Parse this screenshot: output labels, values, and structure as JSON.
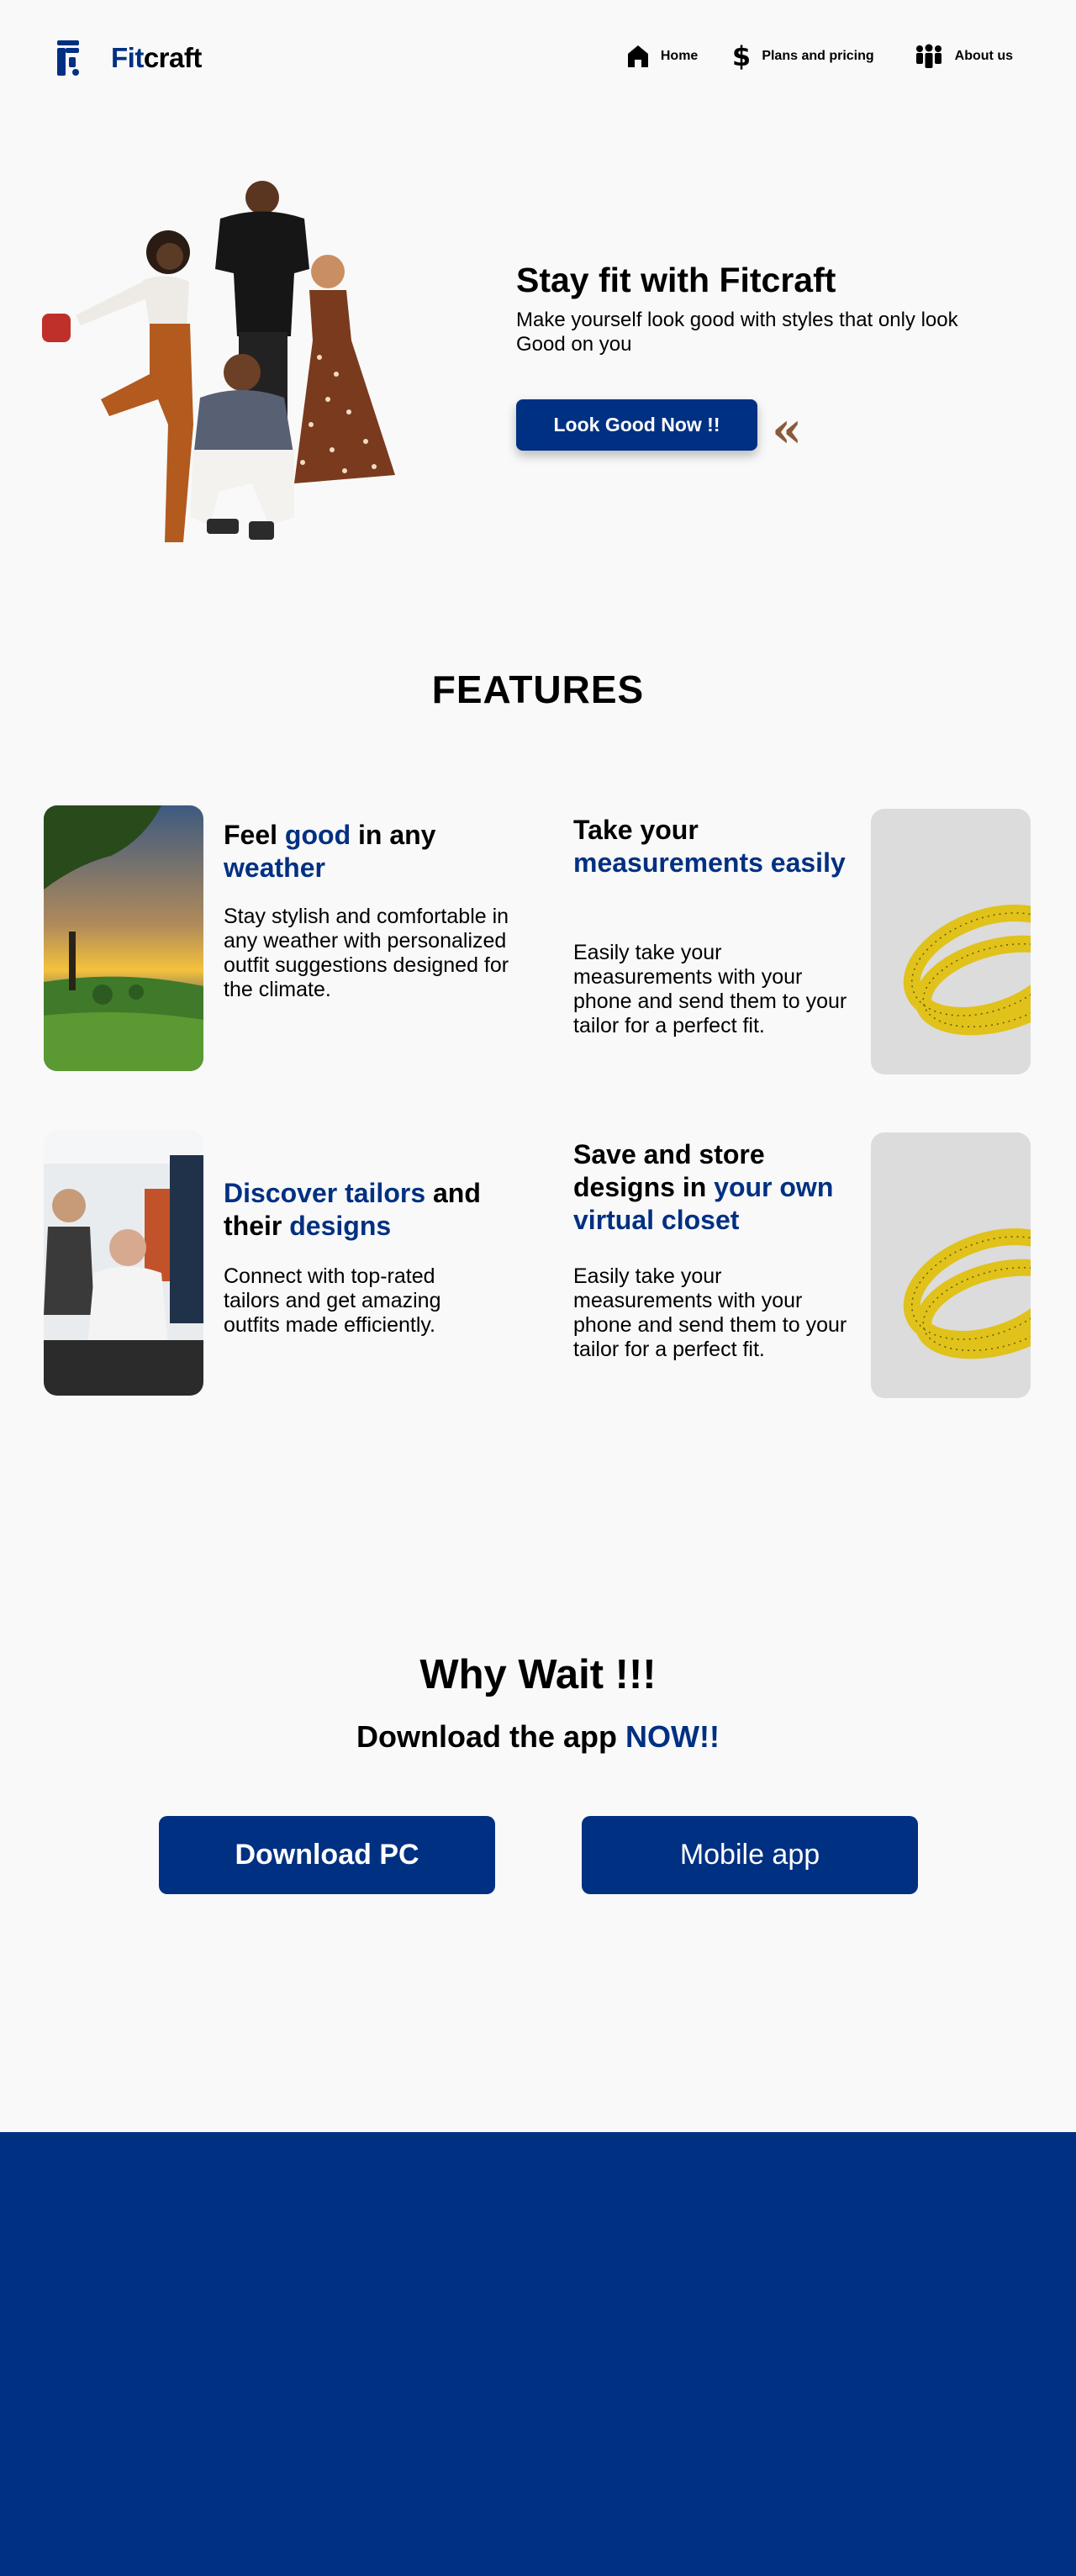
{
  "brand": {
    "prefix": "Fit",
    "suffix": "craft"
  },
  "nav": [
    {
      "icon": "home-icon",
      "label": "Home"
    },
    {
      "icon": "dollar-icon",
      "label": "Plans and pricing"
    },
    {
      "icon": "people-icon",
      "label": "About us"
    }
  ],
  "hero": {
    "title": "Stay fit with Fitcraft",
    "subtitle": "Make yourself look good with styles that only look Good on you",
    "cta": "Look Good Now !!",
    "quote_glyph": "<<"
  },
  "features": {
    "heading": "FEATURES",
    "items": [
      {
        "title_parts": [
          "Feel ",
          "good",
          " in any ",
          "weather"
        ],
        "text": "Stay stylish and comfortable in any weather with personalized outfit suggestions designed for the climate."
      },
      {
        "title_parts": [
          "Take your ",
          "measurements easily"
        ],
        "text": "Easily take your measurements with your phone and send them to your tailor for a perfect fit."
      },
      {
        "title_parts": [
          "Discover tailors",
          " and their ",
          "designs"
        ],
        "text": "Connect with top-rated tailors and get amazing outfits made efficiently."
      },
      {
        "title_parts": [
          "Save and store designs in ",
          "your own virtual closet"
        ],
        "text": "Easily take your measurements with your phone and send them to your tailor for a perfect fit."
      }
    ]
  },
  "download": {
    "title": "Why Wait !!!",
    "subtitle_prefix": "Download the app ",
    "subtitle_accent": "NOW!!",
    "pc_label": "Download PC",
    "mobile_label": "Mobile app"
  },
  "colors": {
    "primary": "#003082",
    "background": "#f9f9f9",
    "accent_brown": "#8a5a3c"
  }
}
